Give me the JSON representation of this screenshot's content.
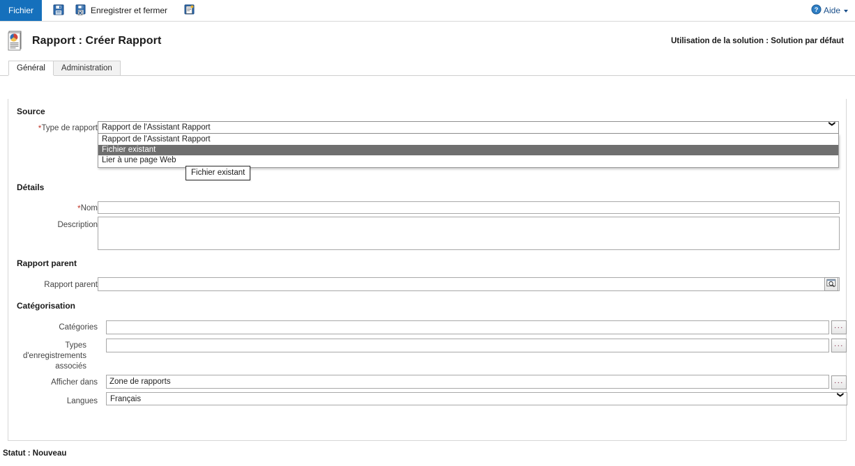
{
  "ribbon": {
    "file_tab": "Fichier",
    "commands": [
      {
        "name": "save",
        "label": "",
        "icon": "save-icon"
      },
      {
        "name": "save-and-close",
        "label": "Enregistrer et fermer",
        "icon": "save-close-icon"
      },
      {
        "name": "new",
        "label": "",
        "icon": "new-record-icon"
      }
    ],
    "help_label": "Aide",
    "help_icon": "help-circle-icon"
  },
  "header": {
    "title": "Rapport : Créer Rapport",
    "icon": "report-document-icon",
    "solution_info": "Utilisation de la solution : Solution par défaut"
  },
  "tabs": [
    {
      "label": "Général",
      "active": true
    },
    {
      "label": "Administration",
      "active": false
    }
  ],
  "form": {
    "sections": {
      "source": "Source",
      "details": "Détails",
      "parent": "Rapport parent",
      "categorisation": "Catégorisation"
    },
    "report_type": {
      "label": "Type de rapport",
      "required": true,
      "value": "Rapport de l'Assistant Rapport",
      "options": [
        "Rapport de l'Assistant Rapport",
        "Fichier existant",
        "Lier à une page Web"
      ],
      "highlighted_option": "Fichier existant",
      "expanded": true
    },
    "tooltip": "Fichier existant",
    "name": {
      "label": "Nom",
      "required": true,
      "value": "",
      "placeholder": ""
    },
    "description": {
      "label": "Description",
      "value": "",
      "placeholder": ""
    },
    "parent_report": {
      "label": "Rapport parent",
      "value": "",
      "placeholder": "",
      "lookup_icon": "lookup-search-icon"
    },
    "categories": {
      "label": "Catégories",
      "value": "",
      "placeholder": "",
      "button_label": "..."
    },
    "related_record_types": {
      "label": "Types d'enregistrements associés",
      "value": "",
      "placeholder": "",
      "button_label": "..."
    },
    "display_in": {
      "label": "Afficher dans",
      "value": "Zone de rapports",
      "button_label": "..."
    },
    "languages": {
      "label": "Langues",
      "value": "Français"
    }
  },
  "statusbar": {
    "text": "Statut : Nouveau"
  },
  "colors": {
    "file_tab_blue": "#1570bc",
    "required_red": "#c0392b",
    "highlight_gray": "#6f6f6f",
    "help_link": "#1a4f8a"
  }
}
